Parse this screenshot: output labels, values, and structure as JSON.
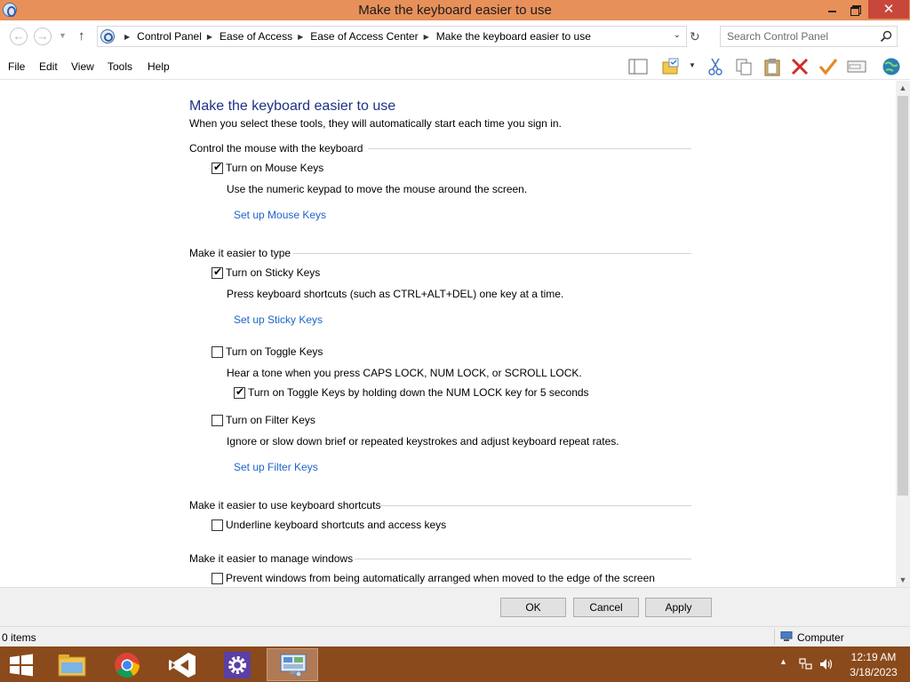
{
  "window": {
    "title": "Make the keyboard easier to use",
    "close_glyph": "✕"
  },
  "address": {
    "breadcrumbs": [
      "Control Panel",
      "Ease of Access",
      "Ease of Access Center",
      "Make the keyboard easier to use"
    ],
    "search_placeholder": "Search Control Panel"
  },
  "menu": [
    "File",
    "Edit",
    "View",
    "Tools",
    "Help"
  ],
  "toolbar_icons": [
    "layout-pane-icon",
    "folder-options-icon",
    "cut-icon",
    "copy-icon",
    "paste-icon",
    "delete-icon",
    "check-icon",
    "properties-icon",
    "globe-icon"
  ],
  "page": {
    "title": "Make the keyboard easier to use",
    "subtitle": "When you select these tools, they will automatically start each time you sign in.",
    "sections": {
      "mouse": {
        "title": "Control the mouse with the keyboard",
        "mouse_keys_label": "Turn on Mouse Keys",
        "mouse_keys_checked": true,
        "mouse_keys_desc": "Use the numeric keypad to move the mouse around the screen.",
        "mouse_keys_link": "Set up Mouse Keys"
      },
      "type": {
        "title": "Make it easier to type",
        "sticky_label": "Turn on Sticky Keys",
        "sticky_checked": true,
        "sticky_desc": "Press keyboard shortcuts (such as CTRL+ALT+DEL) one key at a time.",
        "sticky_link": "Set up Sticky Keys",
        "toggle_label": "Turn on Toggle Keys",
        "toggle_checked": false,
        "toggle_desc": "Hear a tone when you press CAPS LOCK, NUM LOCK, or SCROLL LOCK.",
        "toggle_hold_label": "Turn on Toggle Keys by holding down the NUM LOCK key for 5 seconds",
        "toggle_hold_checked": true,
        "filter_label": "Turn on Filter Keys",
        "filter_checked": false,
        "filter_desc": "Ignore or slow down brief or repeated keystrokes and adjust keyboard repeat rates.",
        "filter_link": "Set up Filter Keys"
      },
      "shortcuts": {
        "title": "Make it easier to use keyboard shortcuts",
        "underline_label": "Underline keyboard shortcuts and access keys",
        "underline_checked": false
      },
      "windows": {
        "title": "Make it easier to manage windows",
        "prevent_label": "Prevent windows from being automatically arranged when moved to the edge of the screen",
        "prevent_checked": false
      }
    }
  },
  "buttons": {
    "ok": "OK",
    "cancel": "Cancel",
    "apply": "Apply"
  },
  "status": {
    "items": "0 items",
    "location": "Computer"
  },
  "taskbar": {
    "apps": [
      "file-explorer-icon",
      "chrome-icon",
      "visual-studio-icon",
      "settings-icon",
      "control-panel-icon"
    ],
    "active_app": "control-panel-icon",
    "time": "12:19 AM",
    "date": "3/18/2023"
  },
  "colors": {
    "titlebar": "#e7905a",
    "close_button": "#c7473b",
    "taskbar": "#8a4a1c",
    "heading": "#1e3287",
    "link": "#1e64c8"
  }
}
